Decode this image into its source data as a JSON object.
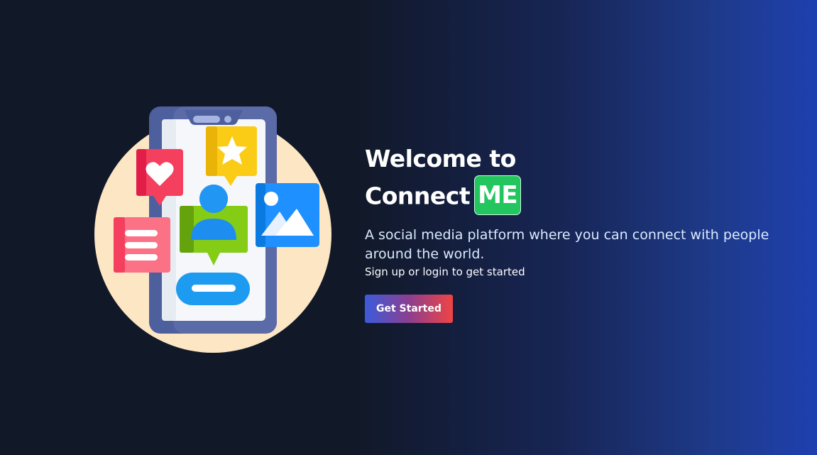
{
  "hero": {
    "title_line1": "Welcome to",
    "title_line2": "Connect",
    "brand_badge": "ME",
    "description": "A social media platform where you can connect with people around the world.",
    "subtext": "Sign up or login to get started",
    "cta_label": "Get Started"
  },
  "colors": {
    "background_dark": "#111827",
    "gradient_end": "#1e40af",
    "brand_green": "#22c55e",
    "cta_start": "#3b5bdb",
    "cta_end": "#ef4444"
  },
  "illustration": {
    "icons": [
      "heart-icon",
      "star-icon",
      "user-icon",
      "image-icon",
      "text-lines-icon",
      "message-bar-icon"
    ]
  }
}
